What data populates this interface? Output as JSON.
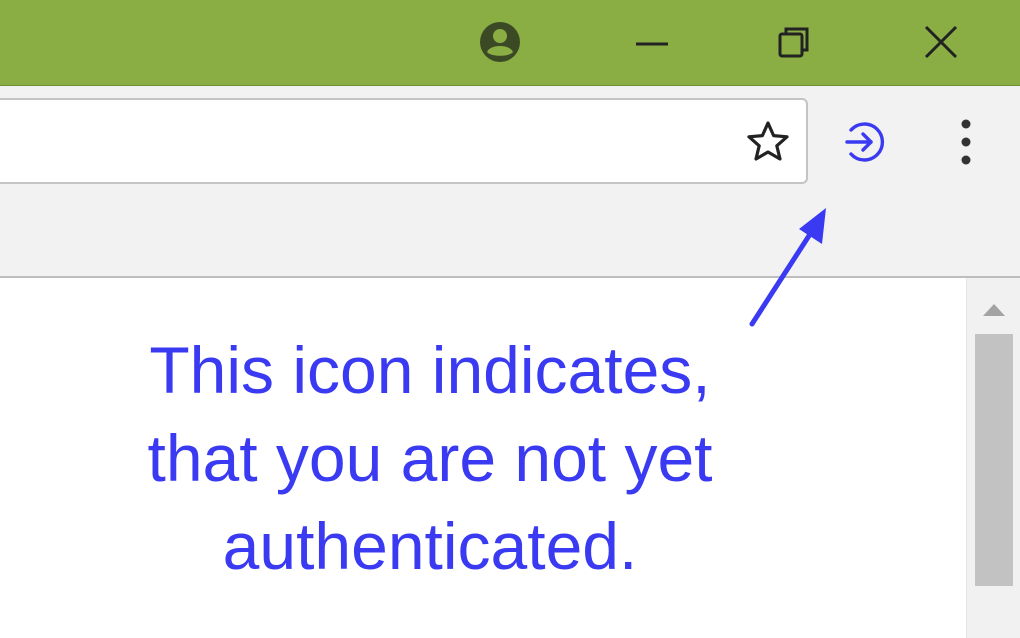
{
  "colors": {
    "titlebar": "#8aae44",
    "toolbar": "#f2f2f2",
    "annotation": "#3a3af2",
    "icon_dark": "#333333",
    "titlebar_icon": "#3b4a25"
  },
  "titlebar": {
    "profile_icon": "account-circle-icon",
    "minimize_icon": "minimize-icon",
    "restore_icon": "restore-icon",
    "close_icon": "close-icon"
  },
  "toolbar": {
    "address_value": "",
    "bookmark_icon": "star-outline-icon",
    "auth_icon": "sign-in-arrow-icon",
    "menu_icon": "vertical-dots-icon"
  },
  "annotation": {
    "lines": [
      "This icon indicates,",
      "that you are not yet",
      "authenticated."
    ]
  }
}
